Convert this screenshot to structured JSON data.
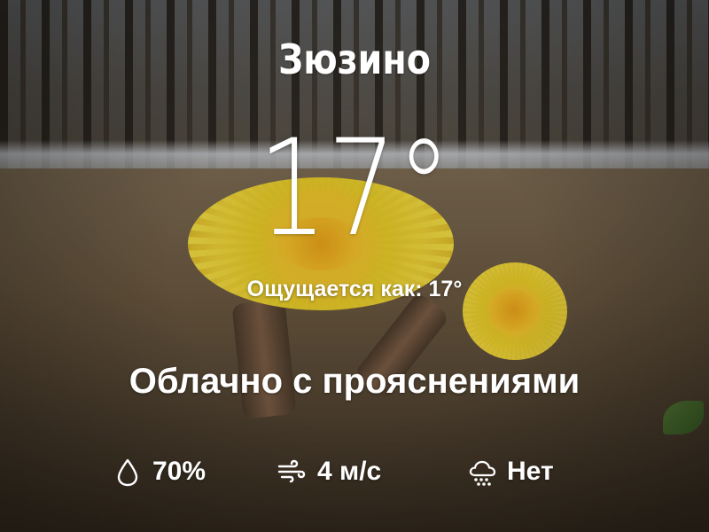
{
  "weather": {
    "city": "Зюзино",
    "temperature": "17°",
    "feels_like": "Ощущается как: 17°",
    "condition": "Облачно с прояснениями",
    "stats": {
      "humidity": {
        "icon": "droplet-icon",
        "value": "70%"
      },
      "wind": {
        "icon": "wind-icon",
        "value": "4 м/с"
      },
      "precipitation": {
        "icon": "rain-cloud-icon",
        "value": "Нет"
      }
    }
  },
  "background": {
    "description_icon": "photo-background"
  },
  "colors": {
    "text": "#ffffff"
  }
}
